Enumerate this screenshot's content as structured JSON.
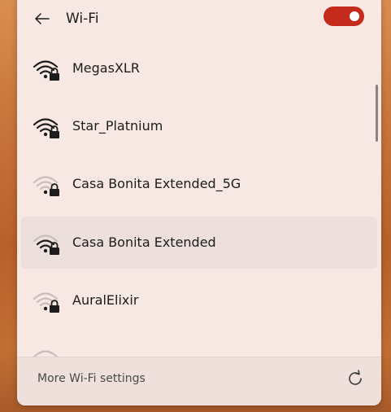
{
  "header": {
    "title": "Wi-Fi",
    "back_icon": "back-arrow-icon",
    "toggle_on": true,
    "toggle_color": "#c42b1c"
  },
  "networks": [
    {
      "name": "MegasXLR",
      "signal": "strong",
      "secured": true
    },
    {
      "name": "Star_Platnium",
      "signal": "strong",
      "secured": true
    },
    {
      "name": "Casa Bonita Extended_5G",
      "signal": "weak",
      "secured": true
    },
    {
      "name": "Casa Bonita Extended",
      "signal": "medium",
      "secured": true
    },
    {
      "name": "AuralElixir",
      "signal": "weak",
      "secured": true
    }
  ],
  "footer": {
    "more_settings": "More Wi-Fi settings",
    "refresh_icon": "refresh-icon"
  }
}
